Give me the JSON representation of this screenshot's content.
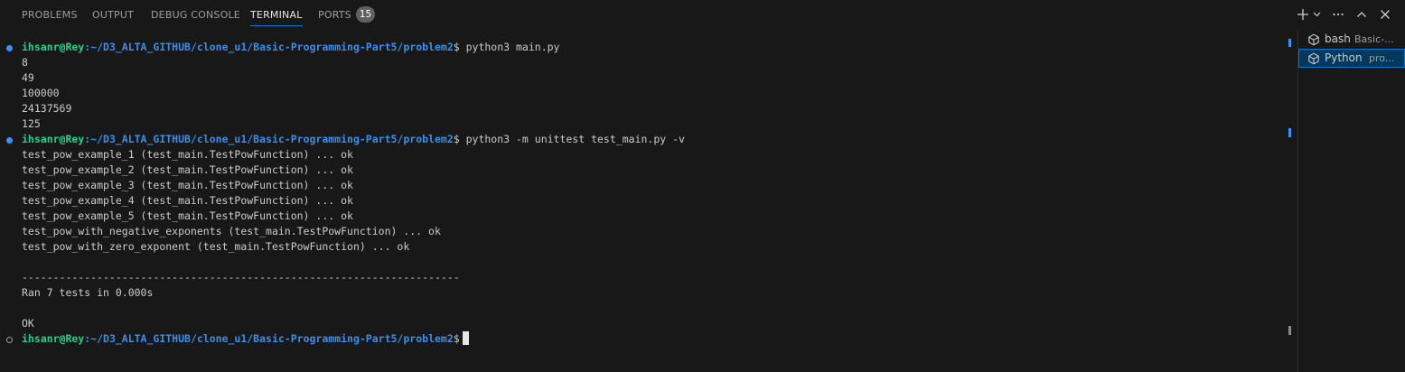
{
  "panel": {
    "tabs": [
      {
        "label": "PROBLEMS"
      },
      {
        "label": "OUTPUT"
      },
      {
        "label": "DEBUG CONSOLE"
      },
      {
        "label": "TERMINAL"
      },
      {
        "label": "PORTS"
      }
    ],
    "ports_count": "15",
    "actions": {
      "new_terminal": "plus-icon",
      "dropdown": "chevron-down-icon",
      "more": "ellipsis-icon",
      "maximize": "chevron-up-icon",
      "close": "close-icon"
    }
  },
  "terminal": {
    "prompt": {
      "user": "ihsanr@Rey",
      "path": ":~/D3_ALTA_GITHUB/clone_u1/Basic-Programming-Part5/problem2",
      "symbol": "$"
    },
    "command1": " python3 main.py",
    "output1": [
      "8",
      "49",
      "100000",
      "24137569",
      "125"
    ],
    "command2": " python3 -m unittest test_main.py -v",
    "test_results": [
      "test_pow_example_1 (test_main.TestPowFunction) ... ok",
      "test_pow_example_2 (test_main.TestPowFunction) ... ok",
      "test_pow_example_3 (test_main.TestPowFunction) ... ok",
      "test_pow_example_4 (test_main.TestPowFunction) ... ok",
      "test_pow_example_5 (test_main.TestPowFunction) ... ok",
      "test_pow_with_negative_exponents (test_main.TestPowFunction) ... ok",
      "test_pow_with_zero_exponent (test_main.TestPowFunction) ... ok"
    ],
    "separator": "----------------------------------------------------------------------",
    "summary": "Ran 7 tests in 0.000s",
    "status": "OK"
  },
  "terminal_list": [
    {
      "name": "bash",
      "description": "Basic-...",
      "icon": "terminal-icon",
      "selected": false
    },
    {
      "name": "Python",
      "description": "pro...",
      "icon": "terminal-icon",
      "selected": true
    }
  ],
  "colors": {
    "user": "#23d18b",
    "path": "#3b8eea",
    "accent": "#0078d4",
    "success_decoration": "#3794ff"
  }
}
